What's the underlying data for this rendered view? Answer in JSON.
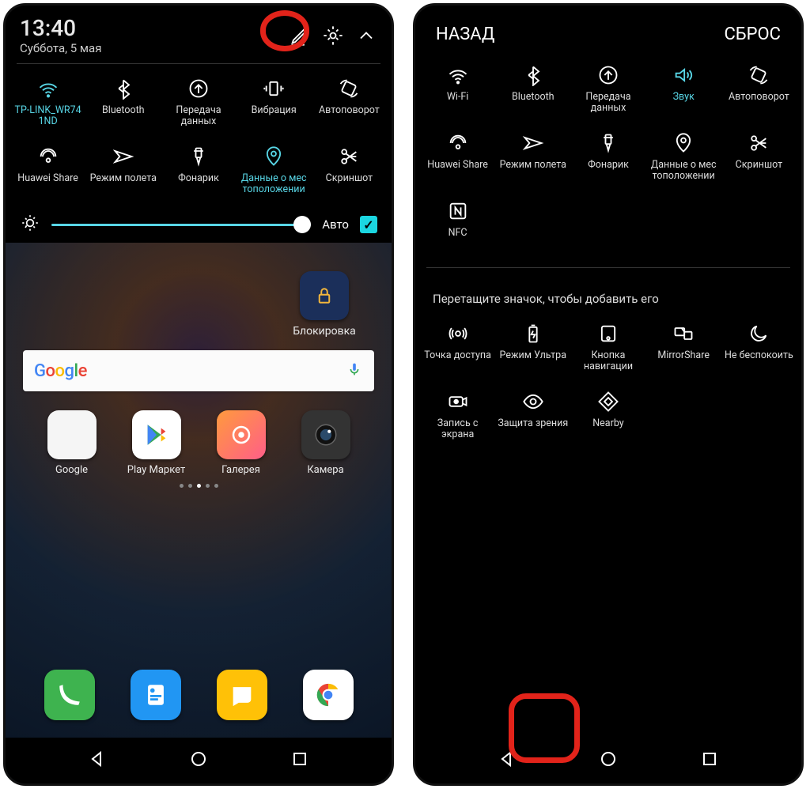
{
  "left": {
    "time": "13:40",
    "date": "Суббота, 5 мая",
    "qs_row1": [
      {
        "icon": "wifi",
        "label": "TP-LINK_WR74 1ND",
        "active": true
      },
      {
        "icon": "bluetooth",
        "label": "Bluetooth",
        "active": false
      },
      {
        "icon": "data",
        "label": "Передача данных",
        "active": false
      },
      {
        "icon": "vibrate",
        "label": "Вибрация",
        "active": false
      },
      {
        "icon": "rotate",
        "label": "Автоповорот",
        "active": false
      }
    ],
    "qs_row2": [
      {
        "icon": "share",
        "label": "Huawei Share",
        "active": false
      },
      {
        "icon": "plane",
        "label": "Режим полета",
        "active": false
      },
      {
        "icon": "flash",
        "label": "Фонарик",
        "active": false
      },
      {
        "icon": "location",
        "label": "Данные о мес тоположении",
        "active": true
      },
      {
        "icon": "scissors",
        "label": "Скриншот",
        "active": false
      }
    ],
    "auto_label": "Авто",
    "auto_checked": true,
    "lock_label": "Блокировка",
    "search_logo": "Google",
    "apps": [
      {
        "label": "Google",
        "bg": "#f5f5f5"
      },
      {
        "label": "Play Маркет",
        "bg": "#fff"
      },
      {
        "label": "Галерея",
        "bg": "linear-gradient(135deg,#ff9a3d,#ff5e88)"
      },
      {
        "label": "Камера",
        "bg": "#333"
      }
    ],
    "dock_colors": [
      "#3eb34f",
      "#2196f3",
      "#ffc107",
      "#fff"
    ]
  },
  "right": {
    "back": "НАЗАД",
    "reset": "СБРОС",
    "enabled": [
      {
        "icon": "wifi",
        "label": "Wi-Fi"
      },
      {
        "icon": "bluetooth",
        "label": "Bluetooth"
      },
      {
        "icon": "data",
        "label": "Передача данных"
      },
      {
        "icon": "sound",
        "label": "Звук",
        "active": true
      },
      {
        "icon": "rotate",
        "label": "Автоповорот"
      },
      {
        "icon": "share",
        "label": "Huawei Share"
      },
      {
        "icon": "plane",
        "label": "Режим полета"
      },
      {
        "icon": "flash",
        "label": "Фонарик"
      },
      {
        "icon": "location",
        "label": "Данные о мес тоположении"
      },
      {
        "icon": "scissors",
        "label": "Скриншот"
      },
      {
        "icon": "nfc",
        "label": "NFC"
      }
    ],
    "drag_hint": "Перетащите значок, чтобы добавить его",
    "available": [
      {
        "icon": "hotspot",
        "label": "Точка доступа"
      },
      {
        "icon": "battery",
        "label": "Режим Ультра"
      },
      {
        "icon": "navkey",
        "label": "Кнопка навигации"
      },
      {
        "icon": "mirror",
        "label": "MirrorShare"
      },
      {
        "icon": "moon",
        "label": "Не беспокоить"
      },
      {
        "icon": "record",
        "label": "Запись с экрана"
      },
      {
        "icon": "eye",
        "label": "Защита зрения",
        "highlight": true
      },
      {
        "icon": "nearby",
        "label": "Nearby"
      }
    ]
  }
}
